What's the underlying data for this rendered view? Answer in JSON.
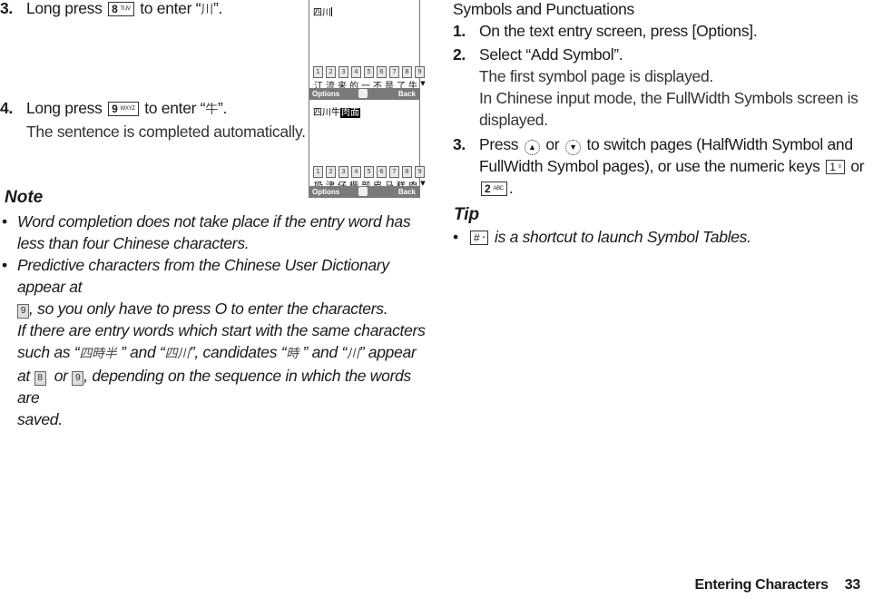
{
  "left_column": {
    "step3": {
      "number": "3.",
      "text_before": "Long press",
      "key": {
        "main": "8",
        "sub": "TUV"
      },
      "text_after": "to enter “",
      "char": "川",
      "close": "”."
    },
    "step4": {
      "number": "4.",
      "text_before": "Long press",
      "key": {
        "main": "9",
        "sub": "WXYZ"
      },
      "text_after": "to enter “",
      "char": "牛",
      "close": "”.",
      "subtext": "The sentence is completed automatically."
    },
    "phone_screen_1": {
      "entry_text": "四川",
      "numbers": [
        "1",
        "2",
        "3",
        "4",
        "5",
        "6",
        "7",
        "8",
        "9"
      ],
      "candidates": [
        "江",
        "流",
        "来",
        "的",
        "一",
        "不",
        "是",
        "了",
        "牛"
      ],
      "more_icon": "▼",
      "softkey_left": "Options",
      "softkey_right": "Back"
    },
    "phone_screen_2": {
      "entry_text": "四川牛",
      "entry_highlight": "肉面",
      "numbers": [
        "1",
        "2",
        "3",
        "4",
        "5",
        "6",
        "7",
        "8",
        "9"
      ],
      "candidates": [
        "奶",
        "津",
        "仔",
        "楷",
        "部",
        "皮",
        "马",
        "糕",
        "肉"
      ],
      "more_icon": "▼",
      "softkey_left": "Options",
      "softkey_right": "Back"
    },
    "note": {
      "heading": "Note",
      "bullet1": "Word completion does not take place if the entry word has less than four Chinese characters.",
      "bullet2_line1": "Predictive characters from the Chinese User Dictionary appear at",
      "bullet2_key9": "9",
      "bullet2_line2": ", so you only have to press O to enter the characters.",
      "bullet2_line3": "If there are entry words which start with the same characters",
      "bullet2_line4_a": "such as “",
      "bullet2_cjk1": "四時半",
      "bullet2_line4_b": " ” and “",
      "bullet2_cjk2": "四川",
      "bullet2_line4_c": "”, candidates “",
      "bullet2_cjk3": "時",
      "bullet2_line4_d": " ” and “",
      "bullet2_cjk4": "川",
      "bullet2_line4_e": "” appear",
      "bullet2_line5_a": "at",
      "bullet2_key8": "8",
      "bullet2_line5_b": "or",
      "bullet2_key9b": "9",
      "bullet2_line5_c": ", depending on the sequence in which the words are",
      "bullet2_line6": "saved."
    }
  },
  "right_column": {
    "section_title": "Symbols and Punctuations",
    "step1": {
      "number": "1.",
      "text": "On the text entry screen, press [Options]."
    },
    "step2": {
      "number": "2.",
      "text": "Select “Add Symbol”.",
      "sub1": "The first symbol page is displayed.",
      "sub2": "In Chinese input mode, the FullWidth Symbols screen is displayed."
    },
    "step3": {
      "number": "3.",
      "text_a": "Press",
      "up_icon": "▲",
      "text_b": "or",
      "down_icon": "▼",
      "text_c": "to switch pages (HalfWidth Symbol and",
      "line2_a": "FullWidth Symbol pages), or use the numeric keys",
      "key1": {
        "main": "1",
        "sub": "≡"
      },
      "line2_b": "or",
      "key2": {
        "main": "2",
        "sub": "ABC"
      },
      "line3": "."
    },
    "tip": {
      "heading": "Tip",
      "key": {
        "main": "#",
        "sub": "«"
      },
      "text": "is a shortcut to launch Symbol Tables."
    }
  },
  "footer": {
    "section": "Entering Characters",
    "page": "33"
  }
}
